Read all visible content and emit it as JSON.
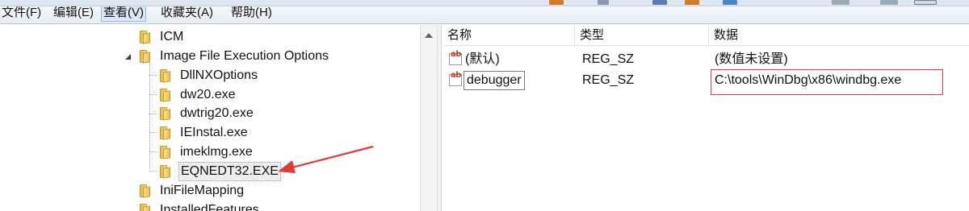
{
  "menu": {
    "items": [
      {
        "label": "文件(F)"
      },
      {
        "label": "编辑(E)"
      },
      {
        "label": "查看(V)"
      },
      {
        "label": "收藏夹(A)"
      },
      {
        "label": "帮助(H)"
      }
    ]
  },
  "tree": {
    "nodes": [
      {
        "label": "ICM",
        "state": "collapsed"
      },
      {
        "label": "Image File Execution Options",
        "state": "expanded"
      },
      {
        "label": "DllNXOptions"
      },
      {
        "label": "dw20.exe"
      },
      {
        "label": "dwtrig20.exe"
      },
      {
        "label": "IEInstal.exe"
      },
      {
        "label": "imeklmg.exe"
      },
      {
        "label": "EQNEDT32.EXE",
        "selected": true
      },
      {
        "label": "IniFileMapping",
        "state": "collapsed"
      },
      {
        "label": "InstalledFeatures",
        "state": "collapsed"
      }
    ]
  },
  "values": {
    "columns": {
      "name": "名称",
      "type": "类型",
      "data": "数据"
    },
    "rows": [
      {
        "name": "(默认)",
        "type": "REG_SZ",
        "data": "(数值未设置)",
        "icon": "string-value-icon"
      },
      {
        "name": "debugger",
        "type": "REG_SZ",
        "data": "C:\\tools\\WinDbg\\x86\\windbg.exe",
        "icon": "string-value-icon",
        "editing": true
      }
    ]
  },
  "colors": {
    "annotation": "#e03a3a",
    "menubar": "#e7edf5"
  }
}
